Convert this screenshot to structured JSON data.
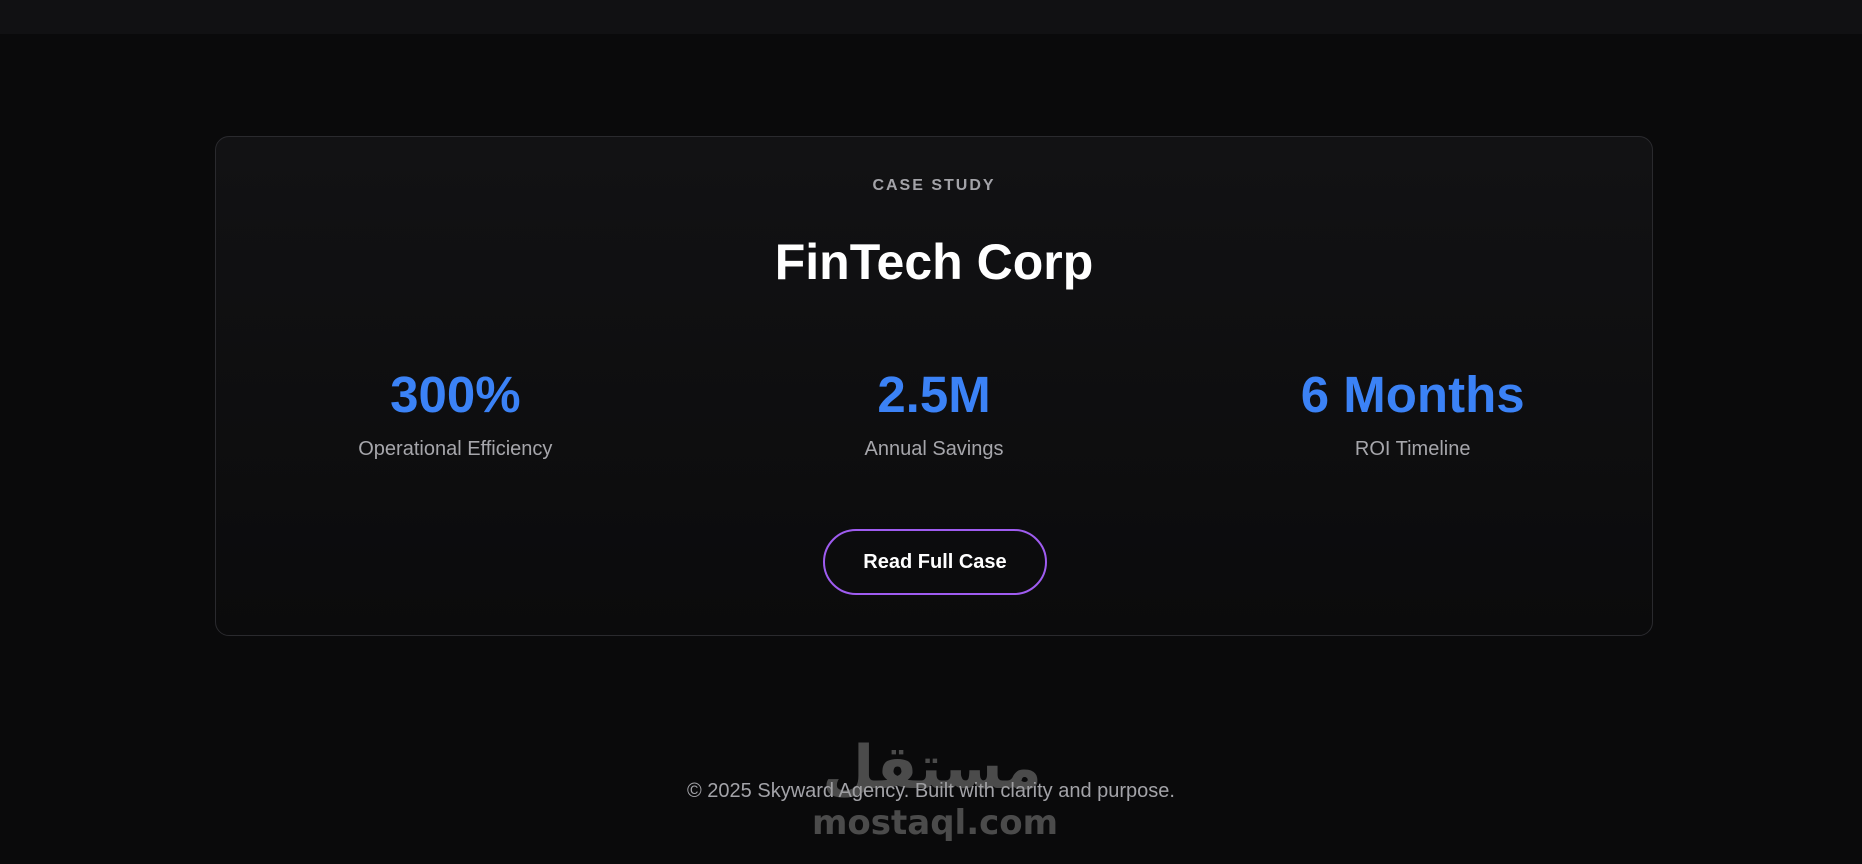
{
  "case_study": {
    "eyebrow": "CASE STUDY",
    "title": "FinTech Corp",
    "stats": [
      {
        "value": "300%",
        "label": "Operational Efficiency"
      },
      {
        "value": "2.5M",
        "label": "Annual Savings"
      },
      {
        "value": "6 Months",
        "label": "ROI Timeline"
      }
    ],
    "cta_label": "Read Full Case"
  },
  "footer": {
    "copyright": "© 2025 Skyward Agency. Built with clarity and purpose."
  },
  "watermark": {
    "arabic": "مستقل",
    "latin": "mostaql.com"
  },
  "colors": {
    "background": "#0a0a0b",
    "accent_blue": "#3b82f6",
    "button_border": "#9f5cf0",
    "card_border": "#2a2a2e"
  }
}
